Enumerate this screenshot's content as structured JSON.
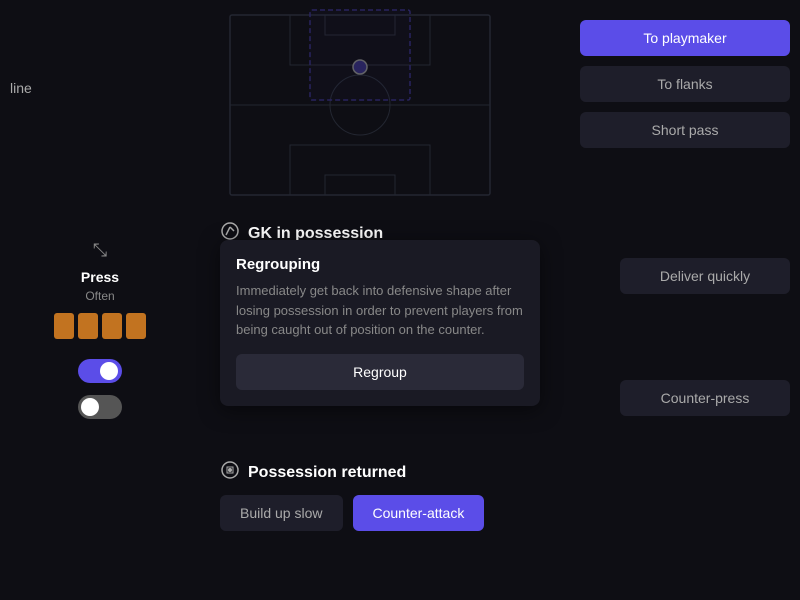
{
  "sidebar": {
    "line_label": "line",
    "compress_icon": "⤡",
    "press_label": "Press",
    "press_sublabel": "Often",
    "bars": [
      {
        "active": true
      },
      {
        "active": true
      },
      {
        "active": true
      },
      {
        "active": true
      }
    ],
    "toggle1": {
      "on": true
    },
    "toggle2": {
      "on": false
    }
  },
  "right_panel": {
    "buttons": [
      {
        "label": "To playmaker",
        "active": true
      },
      {
        "label": "To flanks",
        "active": false
      },
      {
        "label": "Short pass",
        "active": false
      }
    ]
  },
  "gk_section": {
    "title": "GK in possession",
    "icon": "⚽"
  },
  "tooltip": {
    "title": "Regrouping",
    "description": "Immediately get back into defensive shape after losing possession in order to prevent players from being caught out of position on the counter.",
    "button_label": "Regroup"
  },
  "right_options": {
    "deliver_quickly": "Deliver quickly",
    "counter_press": "Counter-press"
  },
  "possession_section": {
    "title": "Possession returned",
    "icon": "⚽",
    "buttons": [
      {
        "label": "Build up slow",
        "active": false
      },
      {
        "label": "Counter-attack",
        "active": true
      }
    ]
  }
}
